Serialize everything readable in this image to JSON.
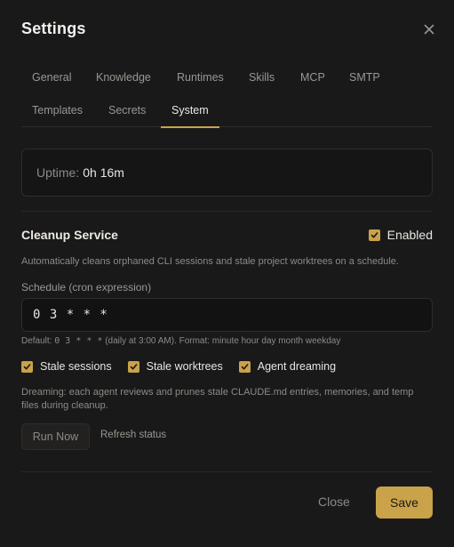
{
  "dialog": {
    "title": "Settings"
  },
  "tabs": [
    {
      "label": "General",
      "active": false
    },
    {
      "label": "Knowledge",
      "active": false
    },
    {
      "label": "Runtimes",
      "active": false
    },
    {
      "label": "Skills",
      "active": false
    },
    {
      "label": "MCP",
      "active": false
    },
    {
      "label": "SMTP",
      "active": false
    },
    {
      "label": "Templates",
      "active": false
    },
    {
      "label": "Secrets",
      "active": false
    },
    {
      "label": "System",
      "active": true
    }
  ],
  "uptime": {
    "label": "Uptime:",
    "value": "0h 16m"
  },
  "cleanup": {
    "title": "Cleanup Service",
    "enabled_label": "Enabled",
    "enabled": true,
    "description": "Automatically cleans orphaned CLI sessions and stale project worktrees on a schedule.",
    "schedule_label": "Schedule (cron expression)",
    "schedule_value": "0 3 * * *",
    "hint_prefix": "Default: ",
    "hint_code": "0 3 * * *",
    "hint_suffix": " (daily at 3:00 AM). Format: minute hour day month weekday",
    "options": [
      {
        "label": "Stale sessions",
        "checked": true
      },
      {
        "label": "Stale worktrees",
        "checked": true
      },
      {
        "label": "Agent dreaming",
        "checked": true
      }
    ],
    "dreaming_note": "Dreaming: each agent reviews and prunes stale CLAUDE.md entries, memories, and temp files during cleanup.",
    "run_now_label": "Run Now",
    "refresh_label": "Refresh status"
  },
  "footer": {
    "close_label": "Close",
    "save_label": "Save"
  },
  "colors": {
    "accent": "#c9a24a",
    "background": "#1a1919",
    "surface": "#161515"
  },
  "icons": {
    "close": "close-icon",
    "checkbox": "checkmark-icon"
  }
}
